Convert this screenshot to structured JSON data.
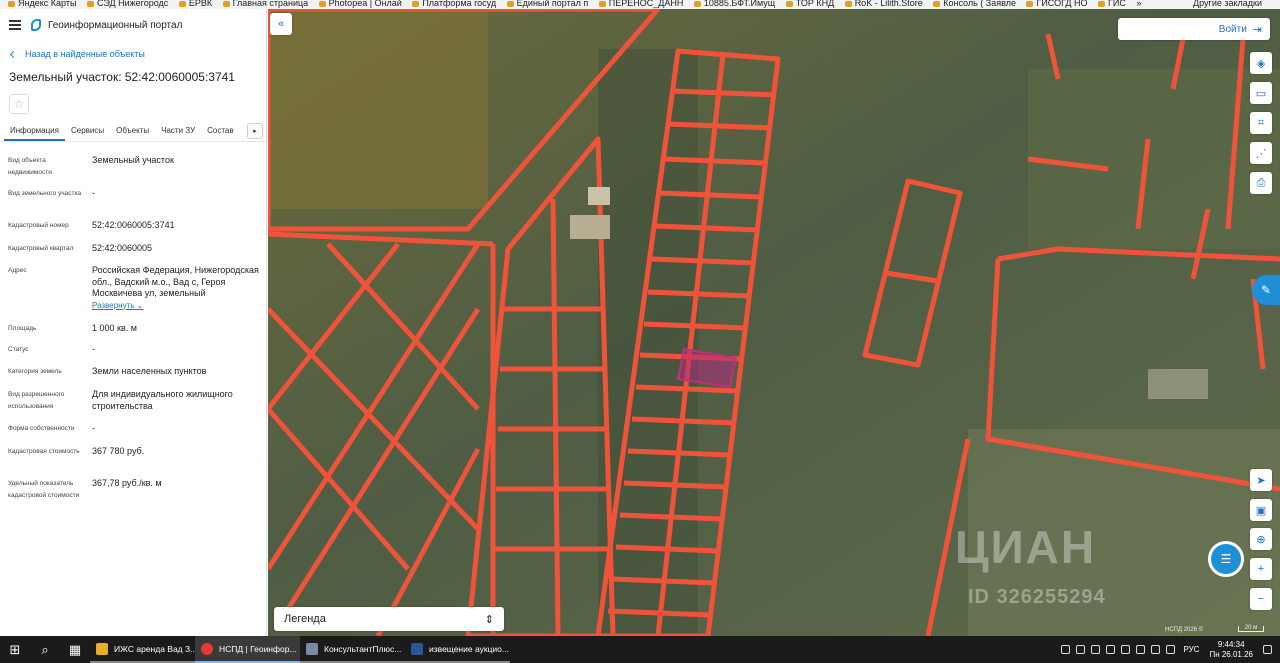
{
  "bookmarks": {
    "items": [
      "Яндекс Карты",
      "СЭД Нижегородс",
      "ЕРВК",
      "Главная страница",
      "Photopea | Онлай",
      "Платформа госуд",
      "Единый портал п",
      "ПЕРЕНОС_ДАНН",
      "10885.БФТ.Имущ",
      "ТОР КНД",
      "RoK - Lilith.Store",
      "Консоль ( Заявле",
      "ГИСОГД НО",
      "ГИС"
    ],
    "more": "»",
    "other": "Другие закладки"
  },
  "panel": {
    "portal_title": "Геоинформационный портал",
    "back_link": "Назад в найденные объекты",
    "object_title": "Земельный участок: 52:42:0060005:3741",
    "star": "☆",
    "tabs": [
      "Информация",
      "Сервисы",
      "Объекты",
      "Части ЗУ",
      "Состав"
    ],
    "tab_arrow": "▸",
    "expand_label": "Развернуть",
    "expand_chevron": "⌄",
    "properties": [
      {
        "label": "Вид объекта недвижимости",
        "value": "Земельный участок"
      },
      {
        "label": "Вид земельного участка",
        "value": "-"
      },
      {
        "label": "Кадастровый номер",
        "value": "52:42:0060005:3741"
      },
      {
        "label": "Кадастровый квартал",
        "value": "52:42:0060005"
      },
      {
        "label": "Адрес",
        "value": "Российская Федерация, Нижегородская обл., Вадский м.о., Вад с, Героя Москвичева ул, земельный"
      },
      {
        "label": "Площадь",
        "value": "1 000 кв. м"
      },
      {
        "label": "Статус",
        "value": "-"
      },
      {
        "label": "Категория земель",
        "value": "Земли населенных пунктов"
      },
      {
        "label": "Вид разрешенного использования",
        "value": "Для индивидуального жилищного строительства"
      },
      {
        "label": "Форма собственности",
        "value": "-"
      },
      {
        "label": "Кадастровая стоимость",
        "value": "367 780 руб."
      },
      {
        "label": "Удельный показатель кадастровой стоимости",
        "value": "367,78 руб./кв. м"
      }
    ]
  },
  "map": {
    "collapse_icon": "«",
    "login_label": "Войти",
    "login_icon": "⇥",
    "legend_label": "Легенда",
    "legend_icon": "⇕",
    "watermark": "ЦИАН",
    "watermark_id": "ID 326255294",
    "copyright": "НСПД 2026 ©",
    "scale": "20 м",
    "tools_top": [
      "◈",
      "▭",
      "⌗",
      "⋰",
      "⎙"
    ],
    "tools_bottom": [
      "➤",
      "▣",
      "⊕",
      "+",
      "−"
    ],
    "parcel_color": "#f0533a",
    "selected_color": "#c0307a"
  },
  "taskbar": {
    "apps": [
      {
        "label": "ИЖС аренда Вад З...",
        "color": "#e8b020"
      },
      {
        "label": "НСПД | Геоинфор...",
        "color": "#e53935"
      },
      {
        "label": "КонсультантПлюс...",
        "color": "#7a8aa0"
      },
      {
        "label": "извещение аукцио...",
        "color": "#2b5797"
      }
    ],
    "lang": "РУС",
    "time": "9:44:34",
    "date": "Пн 26.01.26"
  }
}
